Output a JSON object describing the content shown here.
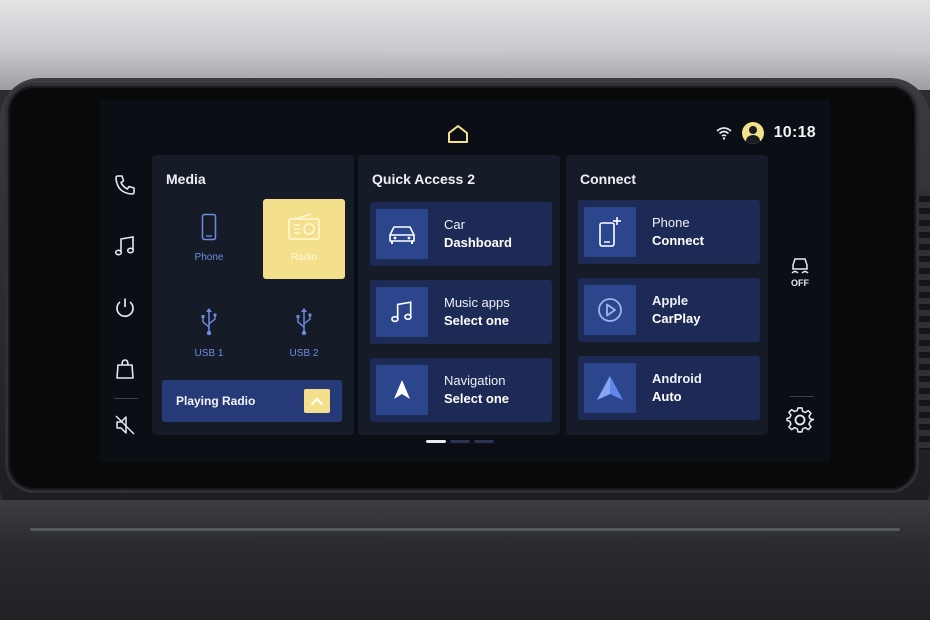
{
  "status": {
    "time": "10:18"
  },
  "rail": {
    "items": [
      "phone-icon",
      "music-note-icon",
      "power-icon",
      "shopping-bag-icon",
      "mute-icon"
    ]
  },
  "media": {
    "title": "Media",
    "items": [
      {
        "label": "Phone",
        "icon": "phone-icon",
        "active": false
      },
      {
        "label": "Radio",
        "icon": "radio-icon",
        "active": true
      },
      {
        "label": "USB 1",
        "icon": "usb-icon",
        "active": false
      },
      {
        "label": "USB 2",
        "icon": "usb-icon",
        "active": false
      }
    ],
    "playing": "Playing Radio"
  },
  "quick_access": {
    "title": "Quick Access 2",
    "tiles": [
      {
        "line1": "Car",
        "line2": "Dashboard",
        "icon": "car-icon"
      },
      {
        "line1": "Music apps",
        "line2": "Select one",
        "icon": "music-note-icon"
      },
      {
        "line1": "Navigation",
        "line2": "Select one",
        "icon": "navigation-arrow-icon"
      }
    ]
  },
  "connect": {
    "title": "Connect",
    "tiles": [
      {
        "line1": "Phone",
        "line2": "Connect",
        "icon": "phone-plus-icon"
      },
      {
        "line1": "Apple",
        "line2": "CarPlay",
        "icon": "carplay-icon"
      },
      {
        "line1": "Android",
        "line2": "Auto",
        "icon": "android-auto-icon"
      }
    ]
  },
  "right_rail": {
    "traction_label": "OFF"
  },
  "colors": {
    "accent": "#f4e08c",
    "tile": "#1d2a55",
    "tile_icon": "#2c468d",
    "panel": "#161b28",
    "link_blue": "#6f8be0"
  },
  "pager": {
    "pages": 3,
    "current": 1
  }
}
